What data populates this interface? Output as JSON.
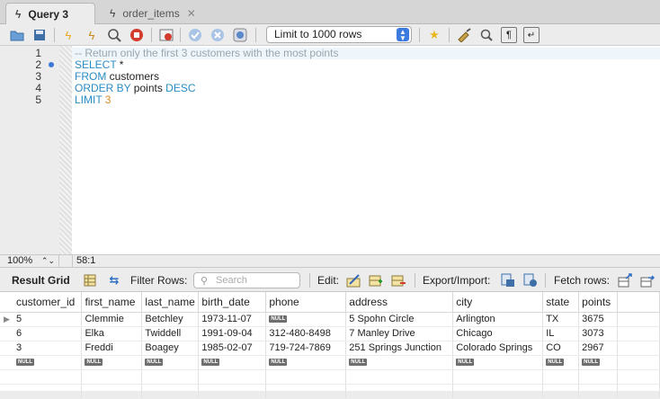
{
  "tabs": [
    {
      "label": "Query 3",
      "active": true
    },
    {
      "label": "order_items",
      "active": false,
      "close": "✕"
    }
  ],
  "toolbar": {
    "limit_select": "Limit to 1000 rows"
  },
  "editor": {
    "line_numbers": [
      "1",
      "2",
      "3",
      "4",
      "5"
    ],
    "lines": [
      [
        {
          "t": "-- Return only the first 3 customers with the most points",
          "c": "cm"
        }
      ],
      [
        {
          "t": "SELECT",
          "c": "kw"
        },
        {
          "t": " *",
          "c": ""
        }
      ],
      [
        {
          "t": "FROM",
          "c": "kw"
        },
        {
          "t": " customers",
          "c": ""
        }
      ],
      [
        {
          "t": "ORDER BY",
          "c": "kw"
        },
        {
          "t": " points ",
          "c": ""
        },
        {
          "t": "DESC",
          "c": "kw"
        }
      ],
      [
        {
          "t": "LIMIT",
          "c": "kw"
        },
        {
          "t": " ",
          "c": ""
        },
        {
          "t": "3",
          "c": "num"
        }
      ]
    ]
  },
  "status": {
    "zoom": "100%",
    "cursor": "58:1"
  },
  "result_toolbar": {
    "result_grid": "Result Grid",
    "filter_rows": "Filter Rows:",
    "search_placeholder": "Search",
    "edit": "Edit:",
    "export_import": "Export/Import:",
    "fetch_rows": "Fetch rows:"
  },
  "grid": {
    "columns": [
      "customer_id",
      "first_name",
      "last_name",
      "birth_date",
      "phone",
      "address",
      "city",
      "state",
      "points"
    ],
    "rows": [
      [
        "5",
        "Clemmie",
        "Betchley",
        "1973-11-07",
        "NULL",
        "5 Spohn Circle",
        "Arlington",
        "TX",
        "3675"
      ],
      [
        "6",
        "Elka",
        "Twiddell",
        "1991-09-04",
        "312-480-8498",
        "7 Manley Drive",
        "Chicago",
        "IL",
        "3073"
      ],
      [
        "3",
        "Freddi",
        "Boagey",
        "1985-02-07",
        "719-724-7869",
        "251 Springs Junction",
        "Colorado Springs",
        "CO",
        "2967"
      ],
      [
        "NULL",
        "NULL",
        "NULL",
        "NULL",
        "NULL",
        "NULL",
        "NULL",
        "NULL",
        "NULL"
      ]
    ]
  }
}
